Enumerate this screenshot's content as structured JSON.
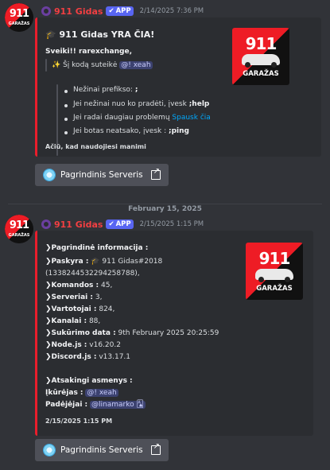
{
  "messages": [
    {
      "username": "911 Gidas",
      "app_badge": "APP",
      "timestamp": "2/14/2025 7:36 PM",
      "avatar_text": {
        "top": "911",
        "bottom": "GARAŽAS"
      },
      "embed": {
        "title": "🎓 911 Gidas YRA ČIA!",
        "greeting": "Sveiki!! rarexchange,",
        "quote": {
          "prefix": "Šį kodą suteikė",
          "mention": "@! xeah"
        },
        "bullets": [
          {
            "text": "Nežinai prefikso:",
            "code": ";"
          },
          {
            "text": "Jei nežinai nuo ko pradėti, įvesk",
            "code": ";help"
          },
          {
            "text": "Jei radai daugiau problemų",
            "link": "Spausk čia"
          },
          {
            "text": "Jei botas neatsako, įvesk :",
            "code": ";ping"
          }
        ],
        "footer": "Ačiū, kad naudojiesi manimi",
        "thumb": {
          "top": "911",
          "bottom": "GARAŽAS"
        }
      },
      "button": "Pagrindinis Serveris"
    },
    {
      "username": "911 Gidas",
      "app_badge": "APP",
      "timestamp": "2/15/2025 1:15 PM",
      "avatar_text": {
        "top": "911",
        "bottom": "GARAŽAS"
      },
      "embed": {
        "section1": "Pagrindinė informacija :",
        "rows": [
          {
            "label": "Paskyra :",
            "value": "🎓 911 Gidas#2018"
          },
          {
            "label": "",
            "value": "(1338244532294258788),"
          },
          {
            "label": "Komandos :",
            "value": "45,"
          },
          {
            "label": "Serveriai :",
            "value": "3,"
          },
          {
            "label": "Vartotojai :",
            "value": "824,"
          },
          {
            "label": "Kanalai :",
            "value": "88,"
          },
          {
            "label": "Sukūrimo data :",
            "value": "9th February 2025 20:25:59"
          },
          {
            "label": "Node.js :",
            "value": "v16.20.2"
          },
          {
            "label": "Discord.js :",
            "value": "v13.17.1"
          }
        ],
        "section2": "Atsakingi asmenys :",
        "creator": {
          "label": "Įkūrėjas :",
          "mention": "@! xeah"
        },
        "helpers": {
          "label": "Padėjėjai :",
          "mention": "@linamarko 🂡"
        },
        "footer": "2/15/2025 1:15 PM",
        "thumb": {
          "top": "911",
          "bottom": "GARAŽAS"
        }
      },
      "button": "Pagrindinis Serveris"
    }
  ],
  "date_divider": "February 15, 2025",
  "colors": {
    "accent": "#e91e2c",
    "app_badge": "#5865f2",
    "username": "#f23f42"
  }
}
